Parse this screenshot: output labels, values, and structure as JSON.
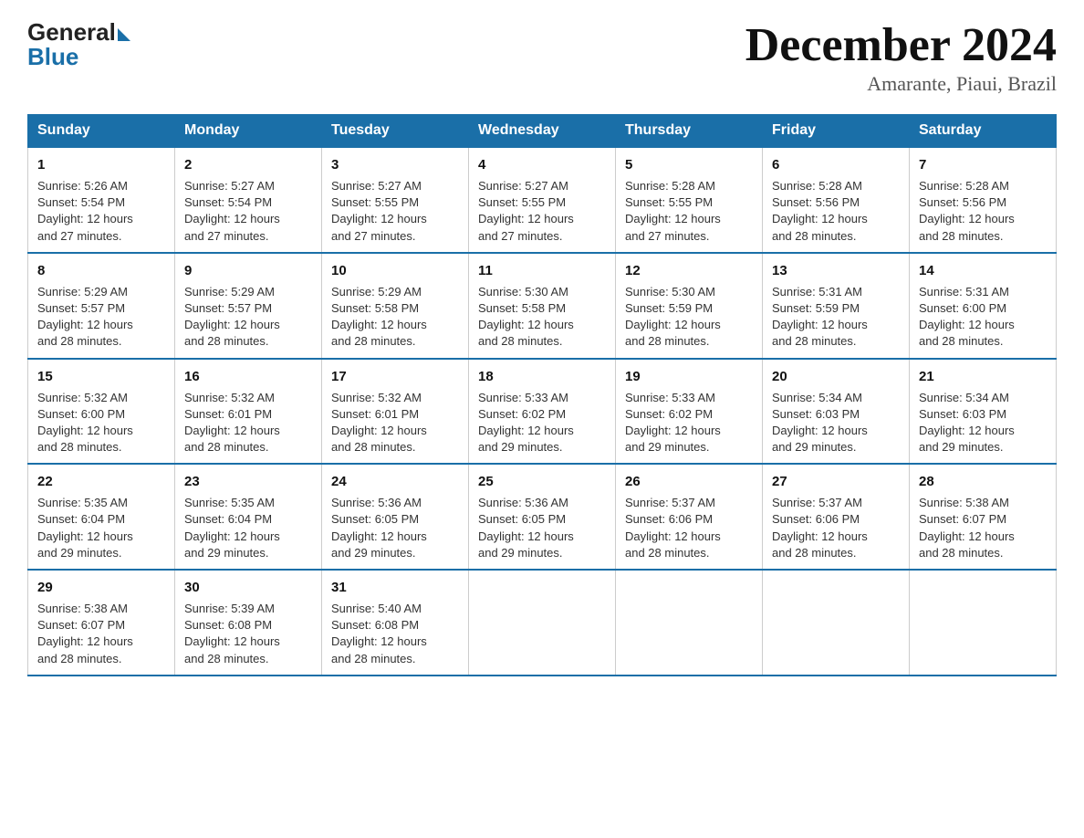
{
  "logo": {
    "general": "General",
    "blue": "Blue"
  },
  "title": "December 2024",
  "location": "Amarante, Piaui, Brazil",
  "days_header": [
    "Sunday",
    "Monday",
    "Tuesday",
    "Wednesday",
    "Thursday",
    "Friday",
    "Saturday"
  ],
  "weeks": [
    [
      {
        "day": "1",
        "sunrise": "5:26 AM",
        "sunset": "5:54 PM",
        "daylight": "12 hours and 27 minutes."
      },
      {
        "day": "2",
        "sunrise": "5:27 AM",
        "sunset": "5:54 PM",
        "daylight": "12 hours and 27 minutes."
      },
      {
        "day": "3",
        "sunrise": "5:27 AM",
        "sunset": "5:55 PM",
        "daylight": "12 hours and 27 minutes."
      },
      {
        "day": "4",
        "sunrise": "5:27 AM",
        "sunset": "5:55 PM",
        "daylight": "12 hours and 27 minutes."
      },
      {
        "day": "5",
        "sunrise": "5:28 AM",
        "sunset": "5:55 PM",
        "daylight": "12 hours and 27 minutes."
      },
      {
        "day": "6",
        "sunrise": "5:28 AM",
        "sunset": "5:56 PM",
        "daylight": "12 hours and 28 minutes."
      },
      {
        "day": "7",
        "sunrise": "5:28 AM",
        "sunset": "5:56 PM",
        "daylight": "12 hours and 28 minutes."
      }
    ],
    [
      {
        "day": "8",
        "sunrise": "5:29 AM",
        "sunset": "5:57 PM",
        "daylight": "12 hours and 28 minutes."
      },
      {
        "day": "9",
        "sunrise": "5:29 AM",
        "sunset": "5:57 PM",
        "daylight": "12 hours and 28 minutes."
      },
      {
        "day": "10",
        "sunrise": "5:29 AM",
        "sunset": "5:58 PM",
        "daylight": "12 hours and 28 minutes."
      },
      {
        "day": "11",
        "sunrise": "5:30 AM",
        "sunset": "5:58 PM",
        "daylight": "12 hours and 28 minutes."
      },
      {
        "day": "12",
        "sunrise": "5:30 AM",
        "sunset": "5:59 PM",
        "daylight": "12 hours and 28 minutes."
      },
      {
        "day": "13",
        "sunrise": "5:31 AM",
        "sunset": "5:59 PM",
        "daylight": "12 hours and 28 minutes."
      },
      {
        "day": "14",
        "sunrise": "5:31 AM",
        "sunset": "6:00 PM",
        "daylight": "12 hours and 28 minutes."
      }
    ],
    [
      {
        "day": "15",
        "sunrise": "5:32 AM",
        "sunset": "6:00 PM",
        "daylight": "12 hours and 28 minutes."
      },
      {
        "day": "16",
        "sunrise": "5:32 AM",
        "sunset": "6:01 PM",
        "daylight": "12 hours and 28 minutes."
      },
      {
        "day": "17",
        "sunrise": "5:32 AM",
        "sunset": "6:01 PM",
        "daylight": "12 hours and 28 minutes."
      },
      {
        "day": "18",
        "sunrise": "5:33 AM",
        "sunset": "6:02 PM",
        "daylight": "12 hours and 29 minutes."
      },
      {
        "day": "19",
        "sunrise": "5:33 AM",
        "sunset": "6:02 PM",
        "daylight": "12 hours and 29 minutes."
      },
      {
        "day": "20",
        "sunrise": "5:34 AM",
        "sunset": "6:03 PM",
        "daylight": "12 hours and 29 minutes."
      },
      {
        "day": "21",
        "sunrise": "5:34 AM",
        "sunset": "6:03 PM",
        "daylight": "12 hours and 29 minutes."
      }
    ],
    [
      {
        "day": "22",
        "sunrise": "5:35 AM",
        "sunset": "6:04 PM",
        "daylight": "12 hours and 29 minutes."
      },
      {
        "day": "23",
        "sunrise": "5:35 AM",
        "sunset": "6:04 PM",
        "daylight": "12 hours and 29 minutes."
      },
      {
        "day": "24",
        "sunrise": "5:36 AM",
        "sunset": "6:05 PM",
        "daylight": "12 hours and 29 minutes."
      },
      {
        "day": "25",
        "sunrise": "5:36 AM",
        "sunset": "6:05 PM",
        "daylight": "12 hours and 29 minutes."
      },
      {
        "day": "26",
        "sunrise": "5:37 AM",
        "sunset": "6:06 PM",
        "daylight": "12 hours and 28 minutes."
      },
      {
        "day": "27",
        "sunrise": "5:37 AM",
        "sunset": "6:06 PM",
        "daylight": "12 hours and 28 minutes."
      },
      {
        "day": "28",
        "sunrise": "5:38 AM",
        "sunset": "6:07 PM",
        "daylight": "12 hours and 28 minutes."
      }
    ],
    [
      {
        "day": "29",
        "sunrise": "5:38 AM",
        "sunset": "6:07 PM",
        "daylight": "12 hours and 28 minutes."
      },
      {
        "day": "30",
        "sunrise": "5:39 AM",
        "sunset": "6:08 PM",
        "daylight": "12 hours and 28 minutes."
      },
      {
        "day": "31",
        "sunrise": "5:40 AM",
        "sunset": "6:08 PM",
        "daylight": "12 hours and 28 minutes."
      },
      null,
      null,
      null,
      null
    ]
  ],
  "labels": {
    "sunrise": "Sunrise:",
    "sunset": "Sunset:",
    "daylight": "Daylight:"
  }
}
